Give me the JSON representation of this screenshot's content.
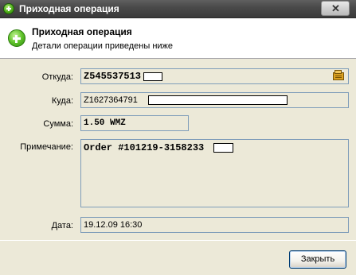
{
  "window": {
    "title": "Приходная операция",
    "close_label": "✕"
  },
  "header": {
    "title": "Приходная операция",
    "subtitle": "Детали операции приведены ниже"
  },
  "fields": {
    "from_label": "Откуда:",
    "from_value": "Z545537513",
    "to_label": "Куда:",
    "to_value": "Z1627364791",
    "amount_label": "Сумма:",
    "amount_value": "1.50 WMZ",
    "note_label": "Примечание:",
    "note_value": "Order #101219-3158233",
    "date_label": "Дата:",
    "date_value": "19.12.09 16:30"
  },
  "footer": {
    "close_button": "Закрыть"
  }
}
